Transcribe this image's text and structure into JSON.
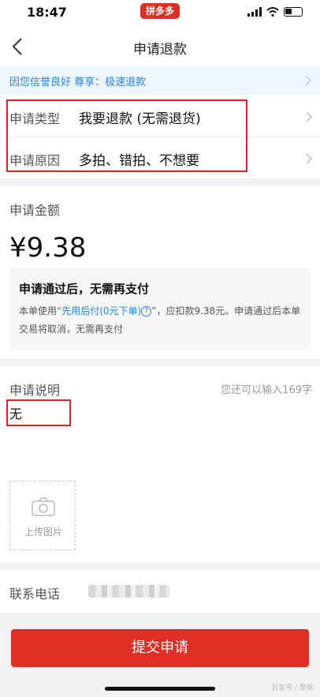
{
  "status_bar": {
    "time": "18:47",
    "app_badge": "拼多多"
  },
  "nav": {
    "title": "申请退款"
  },
  "credit_banner": {
    "text": "因您信誉良好 尊享：极速退款"
  },
  "refund": {
    "type_label": "申请类型",
    "type_value": "我要退款 (无需退货)",
    "reason_label": "申请原因",
    "reason_value": "多拍、错拍、不想要"
  },
  "amount_section": {
    "label": "申请金额",
    "amount": "¥9.38",
    "notice_title": "申请通过后，无需再支付",
    "notice_prefix": "本单使用",
    "notice_link": "“先用后付(0元下单)",
    "notice_mid": "”，应扣款9.38元。申请通过后本单交易将取消，无需再支付"
  },
  "description": {
    "label": "申请说明",
    "remaining": "您还可以输入169字",
    "value": "无",
    "upload_label": "上传图片"
  },
  "contact": {
    "label": "联系电话"
  },
  "submit": {
    "label": "提交申请"
  },
  "watermark": "百家号 / 聚焦",
  "colors": {
    "brand_red": "#e02e24",
    "link_blue": "#2a82e4",
    "highlight_red": "#e02020"
  },
  "icons": [
    "back-arrow-icon",
    "chevron-right-icon",
    "help-circle-icon",
    "camera-icon",
    "signal-icon",
    "wifi-icon",
    "battery-icon"
  ]
}
